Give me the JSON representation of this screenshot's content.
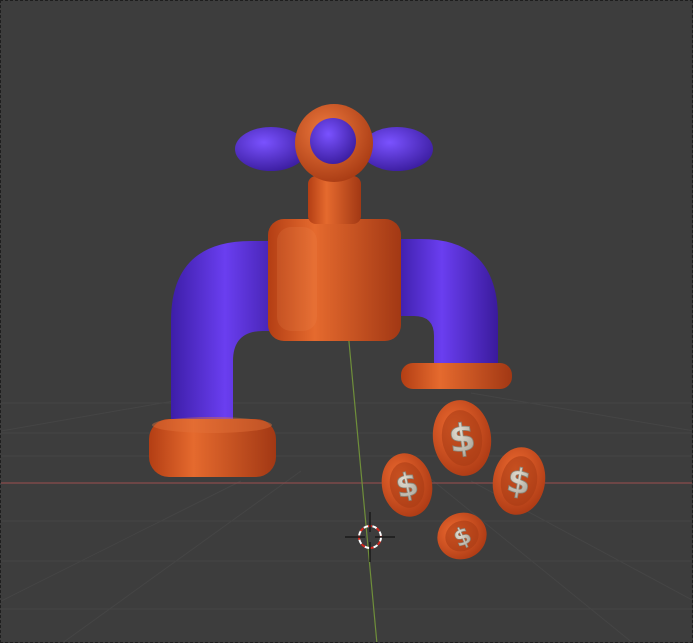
{
  "viewport": {
    "background": "#3d3d3d",
    "grid_color": "#454545",
    "x_axis_color": "#8a4d4d",
    "y_axis_color": "#6f8f3a"
  },
  "scene": {
    "objects": [
      "faucet",
      "coins"
    ],
    "colors": {
      "pipe": "#5b32d8",
      "body": "#d85a22",
      "coin": "#d8541c",
      "coin_face": "#c9c4b8"
    },
    "coins": [
      {
        "symbol": "$"
      },
      {
        "symbol": "$"
      },
      {
        "symbol": "$"
      },
      {
        "symbol": "$"
      }
    ]
  },
  "icons": [
    "3d-cursor-icon"
  ]
}
